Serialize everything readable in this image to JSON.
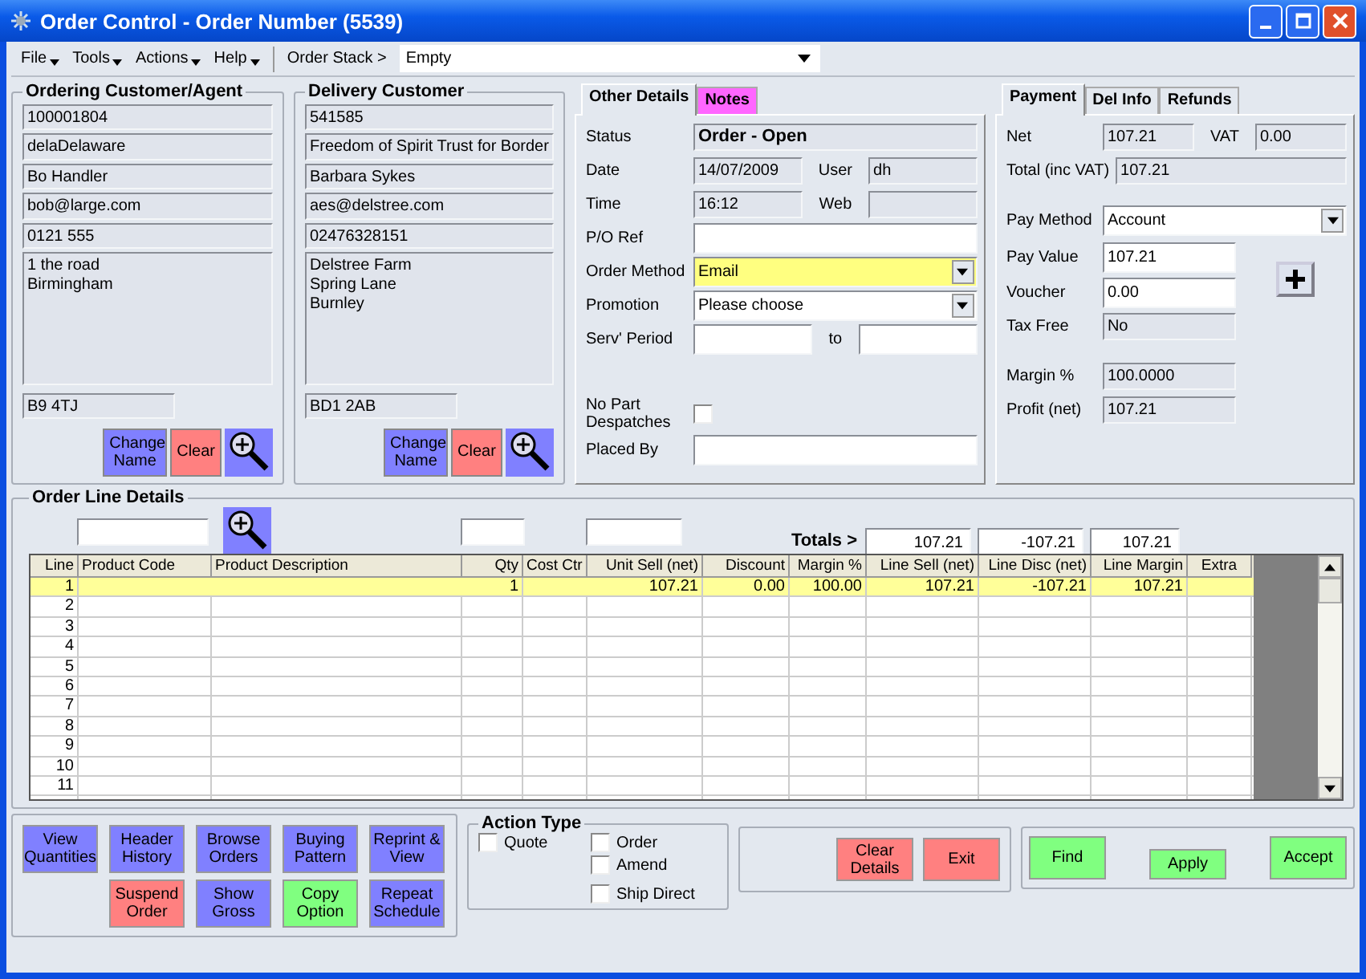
{
  "window": {
    "title": "Order Control -  Order Number (5539)"
  },
  "menu": [
    {
      "label": "File"
    },
    {
      "label": "Tools"
    },
    {
      "label": "Actions"
    },
    {
      "label": "Help"
    }
  ],
  "order_stack": {
    "label": "Order Stack >",
    "value": "Empty"
  },
  "customers": [
    {
      "title": "Ordering Customer/Agent",
      "fields": [
        "100001804",
        "delaDelaware",
        "Bo Handler",
        "bob@large.com",
        "0121 555"
      ],
      "address": [
        "1 the road",
        "Birmingham"
      ],
      "postcode": "B9 4TJ",
      "buttons": [
        {
          "label": "Change Name",
          "color": "#8080ff"
        },
        {
          "label": "Clear",
          "color": "#ff8080"
        }
      ]
    },
    {
      "title": "Delivery Customer",
      "fields": [
        "541585",
        "Freedom of Spirit Trust for Border",
        "Barbara Sykes",
        "aes@delstree.com",
        "02476328151"
      ],
      "address": [
        "Delstree Farm",
        "Spring Lane",
        "Burnley"
      ],
      "postcode": "BD1 2AB",
      "buttons": [
        {
          "label": "Change Name",
          "color": "#8080ff"
        },
        {
          "label": "Clear",
          "color": "#ff8080"
        }
      ]
    }
  ],
  "other_details": {
    "tabs": [
      {
        "label": "Other Details",
        "selected": true,
        "color": "#e3e8ef"
      },
      {
        "label": "Notes",
        "selected": false,
        "color": "#ff66ff"
      }
    ],
    "rows": [
      {
        "label": "Status",
        "items": [
          {
            "kind": "readonly",
            "value": "Order - Open",
            "bold": true
          }
        ]
      },
      {
        "label": "Date",
        "items": [
          {
            "kind": "readonly",
            "value": "14/07/2009"
          },
          {
            "kind": "text",
            "value": "User"
          },
          {
            "kind": "readonly",
            "value": "dh"
          }
        ]
      },
      {
        "label": "Time",
        "items": [
          {
            "kind": "readonly",
            "value": "16:12"
          },
          {
            "kind": "text",
            "value": "Web"
          },
          {
            "kind": "readonly"
          }
        ]
      },
      {
        "label": "P/O Ref",
        "items": [
          {
            "kind": "input"
          }
        ]
      },
      {
        "label": "Order Method",
        "items": [
          {
            "kind": "select",
            "value": "Email",
            "highlighted": true
          }
        ]
      },
      {
        "label": "Promotion",
        "items": [
          {
            "kind": "select",
            "value": "Please choose",
            "highlighted": false
          }
        ]
      },
      {
        "label": "Serv'  Period",
        "items": [
          {
            "kind": "input"
          },
          {
            "kind": "text",
            "value": "to"
          },
          {
            "kind": "input"
          }
        ]
      },
      {
        "kind": "gap"
      },
      {
        "label": "No Part Despatches",
        "items": [
          {
            "kind": "checkbox",
            "checked": false
          }
        ]
      },
      {
        "label": "Placed By",
        "items": [
          {
            "kind": "input"
          }
        ]
      }
    ]
  },
  "payment": {
    "tabs": [
      {
        "label": "Payment",
        "selected": true
      },
      {
        "label": "Del Info",
        "selected": false
      },
      {
        "label": "Refunds",
        "selected": false
      }
    ],
    "rows": [
      {
        "label": "Net",
        "items": [
          {
            "kind": "readonly",
            "value": "107.21"
          },
          {
            "kind": "text",
            "value": "VAT"
          },
          {
            "kind": "readonly",
            "value": "0.00"
          }
        ]
      },
      {
        "label": "Total (inc VAT)",
        "items": [
          {
            "kind": "readonly",
            "value": "107.21"
          }
        ]
      },
      {
        "kind": "gap"
      },
      {
        "label": "Pay Method",
        "items": [
          {
            "kind": "select",
            "value": "Account",
            "highlighted": false
          }
        ]
      },
      {
        "label": "Pay Value",
        "items": [
          {
            "kind": "input",
            "value": "107.21"
          },
          {
            "kind": "plus"
          }
        ]
      },
      {
        "label": "Voucher",
        "items": [
          {
            "kind": "input",
            "value": "0.00"
          },
          {
            "kind": "spacer"
          }
        ]
      },
      {
        "label": "Tax Free",
        "items": [
          {
            "kind": "readonly",
            "value": "No"
          },
          {
            "kind": "spacer"
          }
        ]
      },
      {
        "kind": "gap"
      },
      {
        "label": "Margin %",
        "items": [
          {
            "kind": "readonly",
            "value": "100.0000"
          },
          {
            "kind": "spacer"
          }
        ]
      },
      {
        "label": "Profit (net)",
        "items": [
          {
            "kind": "readonly",
            "value": "107.21"
          },
          {
            "kind": "spacer"
          }
        ]
      }
    ]
  },
  "order_lines": {
    "title": "Order Line Details",
    "totals_label": "Totals >",
    "totals": [
      "107.21",
      "-107.21",
      "107.21"
    ],
    "columns": [
      "Line",
      "Product Code",
      "Product Description",
      "Qty",
      "Cost Ctr",
      "Unit Sell (net)",
      "Discount",
      "Margin %",
      "Line Sell (net)",
      "Line Disc (net)",
      "Line Margin",
      "Extra"
    ],
    "rows": [
      {
        "cells": [
          "1",
          null,
          null,
          "1",
          null,
          "107.21",
          "0.00",
          "100.00",
          "107.21",
          "-107.21",
          "107.21"
        ],
        "selected": true
      },
      {
        "cells": [
          "2"
        ],
        "selected": false
      },
      {
        "cells": [
          "3"
        ],
        "selected": false
      },
      {
        "cells": [
          "4"
        ],
        "selected": false
      },
      {
        "cells": [
          "5"
        ],
        "selected": false
      },
      {
        "cells": [
          "6"
        ],
        "selected": false
      },
      {
        "cells": [
          "7"
        ],
        "selected": false
      },
      {
        "cells": [
          "8"
        ],
        "selected": false
      },
      {
        "cells": [
          "9"
        ],
        "selected": false
      },
      {
        "cells": [
          "10"
        ],
        "selected": false
      },
      {
        "cells": [
          "11"
        ],
        "selected": false
      }
    ]
  },
  "tool_buttons": [
    [
      {
        "label": "View Quantities",
        "color": "#8080ff"
      },
      {
        "label": "Header History",
        "color": "#8080ff"
      },
      {
        "label": "Browse Orders",
        "color": "#8080ff"
      },
      {
        "label": "Buying Pattern",
        "color": "#8080ff"
      },
      {
        "label": "Reprint & View",
        "color": "#8080ff"
      }
    ],
    [
      {
        "label": "Suspend Order",
        "color": "#ff8080"
      },
      {
        "label": "Show Gross",
        "color": "#8080ff"
      },
      {
        "label": "Copy Option",
        "color": "#80ff80"
      },
      {
        "label": "Repeat Schedule",
        "color": "#8080ff"
      }
    ]
  ],
  "action_type": {
    "title": "Action Type",
    "options": [
      {
        "label": "Quote",
        "checked": false
      },
      {
        "label": "Order",
        "checked": false
      },
      {
        "label": "Amend",
        "checked": false
      },
      {
        "label": "Ship Direct",
        "checked": false
      }
    ]
  },
  "clear_buttons": [
    {
      "label": "Clear Details",
      "color": "#ff8080"
    },
    {
      "label": "Exit",
      "color": "#ff8080"
    }
  ],
  "accept_buttons": [
    {
      "label": "Find",
      "color": "#80ff80"
    },
    {
      "label": "Apply",
      "color": "#80ff80"
    },
    {
      "label": "Accept",
      "color": "#80ff80"
    }
  ]
}
